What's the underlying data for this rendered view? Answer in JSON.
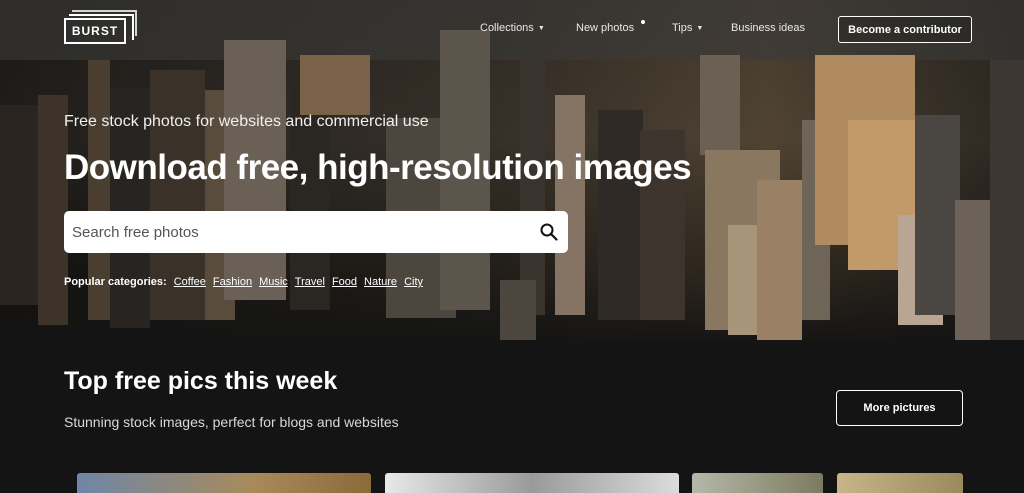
{
  "header": {
    "logo_text": "BURST",
    "nav": [
      {
        "label": "Collections",
        "has_caret": true
      },
      {
        "label": "New photos",
        "has_caret": false
      },
      {
        "label": "Tips",
        "has_caret": true
      },
      {
        "label": "Business ideas",
        "has_caret": false
      }
    ],
    "contributor_button": "Become a contributor"
  },
  "hero": {
    "tagline": "Free stock photos for websites and commercial use",
    "headline": "Download free, high-resolution images",
    "search": {
      "placeholder": "Search free photos",
      "value": "",
      "icon": "search-icon"
    },
    "popular_label": "Popular categories:",
    "categories": [
      "Coffee",
      "Fashion",
      "Music",
      "Travel",
      "Food",
      "Nature",
      "City"
    ]
  },
  "section": {
    "title": "Top free pics this week",
    "subtitle": "Stunning stock images, perfect for blogs and websites",
    "more_button": "More pictures"
  },
  "colors": {
    "background": "#141414",
    "text": "#ffffff",
    "search_bg": "#ffffff"
  }
}
